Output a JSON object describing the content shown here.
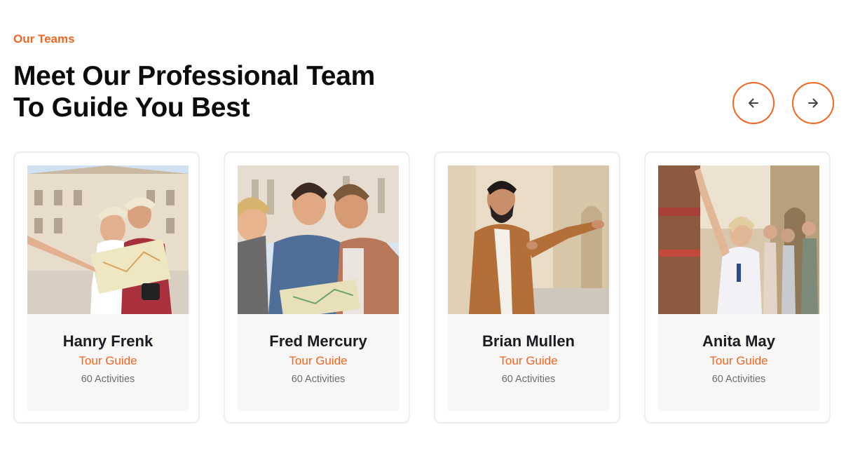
{
  "section": {
    "eyebrow": "Our Teams",
    "title_line1": "Meet Our Professional Team",
    "title_line2": "To Guide You Best"
  },
  "navigation": {
    "prev_icon": "arrow-left-icon",
    "next_icon": "arrow-right-icon"
  },
  "colors": {
    "accent": "#f26522",
    "heading": "#0b0b0b",
    "card_border": "#ececec",
    "card_info_bg": "#f8f7f6",
    "muted_text": "#6d6d6d"
  },
  "team": [
    {
      "name": "Hanry Frenk",
      "role": "Tour Guide",
      "activities": "60 Activities",
      "photo": "tourist-couple-with-map-photo"
    },
    {
      "name": "Fred Mercury",
      "role": "Tour Guide",
      "activities": "60 Activities",
      "photo": "friends-reading-map-photo"
    },
    {
      "name": "Brian Mullen",
      "role": "Tour Guide",
      "activities": "60 Activities",
      "photo": "guide-in-leather-jacket-photo"
    },
    {
      "name": "Anita May",
      "role": "Tour Guide",
      "activities": "60 Activities",
      "photo": "guide-pointing-up-with-group-photo"
    }
  ]
}
